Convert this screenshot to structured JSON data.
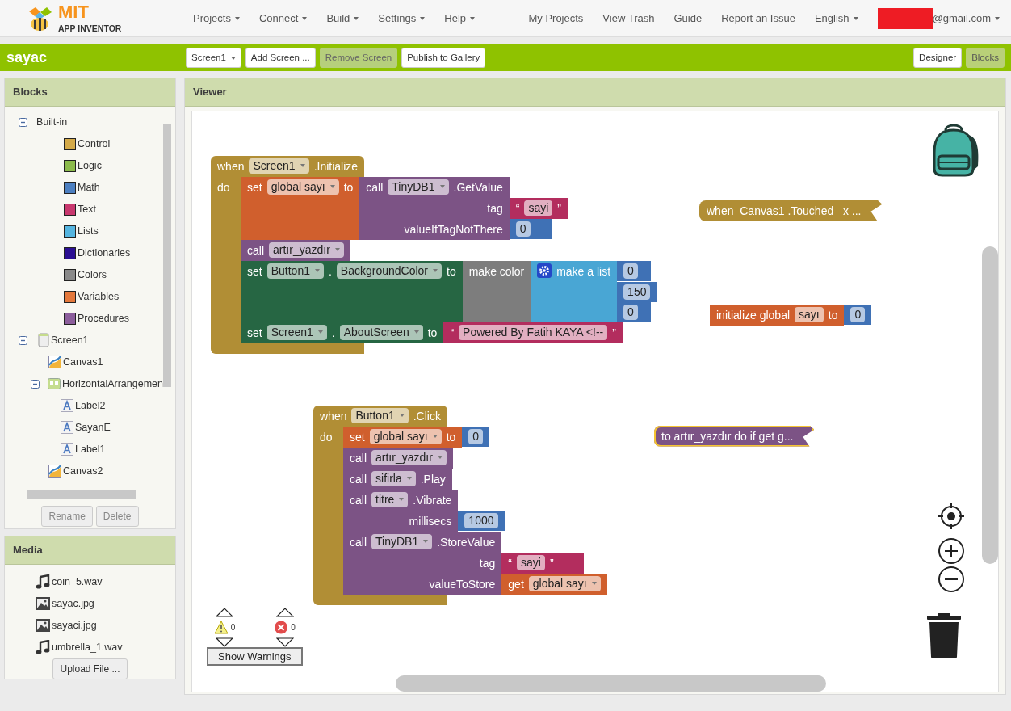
{
  "header": {
    "logo_title": "MIT",
    "logo_subtitle": "APP INVENTOR",
    "menus": [
      {
        "label": "Projects"
      },
      {
        "label": "Connect"
      },
      {
        "label": "Build"
      },
      {
        "label": "Settings"
      },
      {
        "label": "Help"
      }
    ],
    "links": [
      "My Projects",
      "View Trash",
      "Guide",
      "Report an Issue"
    ],
    "language": "English",
    "account": "@gmail.com"
  },
  "toolbar": {
    "project_name": "sayac",
    "buttons": [
      {
        "label": "Screen1",
        "dropdown": true,
        "disabled": false
      },
      {
        "label": "Add Screen ...",
        "dropdown": false,
        "disabled": false
      },
      {
        "label": "Remove Screen",
        "dropdown": false,
        "disabled": true
      },
      {
        "label": "Publish to Gallery",
        "dropdown": false,
        "disabled": false
      }
    ],
    "view_buttons": [
      {
        "label": "Designer",
        "selected": false
      },
      {
        "label": "Blocks",
        "selected": true
      }
    ]
  },
  "blocks_panel": {
    "title": "Blocks",
    "tree": [
      {
        "label": "Built-in",
        "kind": "group",
        "expanded": true,
        "children": [
          {
            "label": "Control",
            "kind": "category",
            "color": "#d4aa49"
          },
          {
            "label": "Logic",
            "kind": "category",
            "color": "#8cbb4c"
          },
          {
            "label": "Math",
            "kind": "category",
            "color": "#4c7fc0"
          },
          {
            "label": "Text",
            "kind": "category",
            "color": "#c8386e"
          },
          {
            "label": "Lists",
            "kind": "category",
            "color": "#55b5e0"
          },
          {
            "label": "Dictionaries",
            "kind": "category",
            "color": "#2b0f92"
          },
          {
            "label": "Colors",
            "kind": "category",
            "color": "#8a8a8a"
          },
          {
            "label": "Variables",
            "kind": "category",
            "color": "#e4783c"
          },
          {
            "label": "Procedures",
            "kind": "category",
            "color": "#8c5e9c"
          }
        ]
      },
      {
        "label": "Screen1",
        "kind": "screen",
        "expanded": true,
        "children": [
          {
            "label": "Canvas1",
            "kind": "canvas"
          },
          {
            "label": "HorizontalArrangemen",
            "kind": "arrangement",
            "expanded": true,
            "children": [
              {
                "label": "Label2",
                "kind": "label"
              },
              {
                "label": "SayanE",
                "kind": "label"
              },
              {
                "label": "Label1",
                "kind": "label"
              }
            ]
          },
          {
            "label": "Canvas2",
            "kind": "canvas"
          }
        ]
      }
    ],
    "buttons": [
      {
        "label": "Rename",
        "disabled": true
      },
      {
        "label": "Delete",
        "disabled": true
      }
    ]
  },
  "media_panel": {
    "title": "Media",
    "files": [
      {
        "name": "coin_5.wav",
        "kind": "audio"
      },
      {
        "name": "sayac.jpg",
        "kind": "image"
      },
      {
        "name": "sayaci.jpg",
        "kind": "image"
      },
      {
        "name": "umbrella_1.wav",
        "kind": "audio"
      }
    ],
    "upload_button": "Upload File ..."
  },
  "viewer": {
    "title": "Viewer",
    "stacks": [
      {
        "selected": false,
        "collapsed": false,
        "block": {
          "kind": "event",
          "rows": [
            {
              "items": [
                {
                  "kind": "label",
                  "text": "when"
                },
                {
                  "kind": "field",
                  "text": "Screen1",
                  "dropdown": true
                },
                {
                  "kind": "label",
                  "text": ".Initialize"
                }
              ]
            }
          ],
          "do_label": "do",
          "statements": [
            {
              "kind": "variable_set",
              "rows": [
                {
                  "items": [
                    {
                      "kind": "label",
                      "text": "set"
                    },
                    {
                      "kind": "field",
                      "text": "global sayı",
                      "dropdown": true
                    },
                    {
                      "kind": "label",
                      "text": "to"
                    }
                  ],
                  "input": {
                    "kind": "component_method",
                    "rows": [
                      {
                        "items": [
                          {
                            "kind": "label",
                            "text": "call"
                          },
                          {
                            "kind": "field",
                            "text": "TinyDB1",
                            "dropdown": true
                          },
                          {
                            "kind": "label",
                            "text": ".GetValue"
                          }
                        ]
                      },
                      {
                        "items": [
                          {
                            "kind": "label",
                            "text": "tag"
                          }
                        ],
                        "input": {
                          "kind": "text",
                          "rows": [
                            {
                              "items": [
                                {
                                  "kind": "label",
                                  "text": "“"
                                },
                                {
                                  "kind": "field",
                                  "text": "sayi",
                                  "dropdown": false
                                },
                                {
                                  "kind": "label",
                                  "text": "”"
                                }
                              ]
                            }
                          ]
                        }
                      },
                      {
                        "items": [
                          {
                            "kind": "label",
                            "text": "valueIfTagNotThere"
                          }
                        ],
                        "input": {
                          "kind": "number",
                          "rows": [
                            {
                              "items": [
                                {
                                  "kind": "field",
                                  "text": "0",
                                  "dropdown": false
                                }
                              ]
                            }
                          ]
                        }
                      }
                    ]
                  }
                }
              ]
            },
            {
              "kind": "procedure_call",
              "rows": [
                {
                  "items": [
                    {
                      "kind": "label",
                      "text": "call"
                    },
                    {
                      "kind": "field",
                      "text": "artır_yazdır",
                      "dropdown": true
                    }
                  ]
                }
              ]
            },
            {
              "kind": "component_set",
              "rows": [
                {
                  "items": [
                    {
                      "kind": "label",
                      "text": "set"
                    },
                    {
                      "kind": "field",
                      "text": "Button1",
                      "dropdown": true
                    },
                    {
                      "kind": "label",
                      "text": "."
                    },
                    {
                      "kind": "field",
                      "text": "BackgroundColor",
                      "dropdown": true
                    },
                    {
                      "kind": "label",
                      "text": "to"
                    }
                  ],
                  "input": {
                    "kind": "color",
                    "rows": [
                      {
                        "items": [
                          {
                            "kind": "label",
                            "text": "make color"
                          }
                        ],
                        "input": {
                          "kind": "list",
                          "mutator": true,
                          "rows": [
                            {
                              "items": [
                                {
                                  "kind": "label",
                                  "text": "make a list"
                                }
                              ],
                              "input": {
                                "kind": "number",
                                "rows": [
                                  {
                                    "items": [
                                      {
                                        "kind": "field",
                                        "text": "0",
                                        "dropdown": false
                                      }
                                    ]
                                  }
                                ]
                              }
                            },
                            {
                              "input": {
                                "kind": "number",
                                "rows": [
                                  {
                                    "items": [
                                      {
                                        "kind": "field",
                                        "text": "150",
                                        "dropdown": false
                                      }
                                    ]
                                  }
                                ]
                              }
                            },
                            {
                              "input": {
                                "kind": "number",
                                "rows": [
                                  {
                                    "items": [
                                      {
                                        "kind": "field",
                                        "text": "0",
                                        "dropdown": false
                                      }
                                    ]
                                  }
                                ]
                              }
                            }
                          ]
                        }
                      }
                    ]
                  }
                }
              ]
            },
            {
              "kind": "component_set",
              "rows": [
                {
                  "items": [
                    {
                      "kind": "label",
                      "text": "set"
                    },
                    {
                      "kind": "field",
                      "text": "Screen1",
                      "dropdown": true
                    },
                    {
                      "kind": "label",
                      "text": "."
                    },
                    {
                      "kind": "field",
                      "text": "AboutScreen",
                      "dropdown": true
                    },
                    {
                      "kind": "label",
                      "text": "to"
                    }
                  ],
                  "input": {
                    "kind": "text",
                    "rows": [
                      {
                        "items": [
                          {
                            "kind": "label",
                            "text": "“"
                          },
                          {
                            "kind": "field",
                            "text": "Powered By Fatih KAYA <!--",
                            "dropdown": false
                          },
                          {
                            "kind": "label",
                            "text": "”"
                          }
                        ]
                      }
                    ]
                  }
                }
              ]
            }
          ]
        }
      },
      {
        "selected": false,
        "collapsed": true,
        "block": {
          "kind": "event",
          "rows": [
            {
              "items": [
                {
                  "kind": "label",
                  "text": "when  Canvas1 .Touched   x ..."
                }
              ]
            }
          ]
        }
      },
      {
        "selected": false,
        "collapsed": false,
        "block": {
          "kind": "variable_init",
          "rows": [
            {
              "items": [
                {
                  "kind": "label",
                  "text": "initialize global"
                },
                {
                  "kind": "field",
                  "text": "sayı",
                  "dropdown": false
                },
                {
                  "kind": "label",
                  "text": "to"
                }
              ],
              "input": {
                "kind": "number",
                "rows": [
                  {
                    "items": [
                      {
                        "kind": "field",
                        "text": "0",
                        "dropdown": false
                      }
                    ]
                  }
                ]
              }
            }
          ]
        }
      },
      {
        "selected": false,
        "collapsed": false,
        "block": {
          "kind": "event",
          "rows": [
            {
              "items": [
                {
                  "kind": "label",
                  "text": "when"
                },
                {
                  "kind": "field",
                  "text": "Button1",
                  "dropdown": true
                },
                {
                  "kind": "label",
                  "text": ".Click"
                }
              ]
            }
          ],
          "do_label": "do",
          "statements": [
            {
              "kind": "variable_set",
              "rows": [
                {
                  "items": [
                    {
                      "kind": "label",
                      "text": "set"
                    },
                    {
                      "kind": "field",
                      "text": "global sayı",
                      "dropdown": true
                    },
                    {
                      "kind": "label",
                      "text": "to"
                    }
                  ],
                  "input": {
                    "kind": "number",
                    "rows": [
                      {
                        "items": [
                          {
                            "kind": "field",
                            "text": "0",
                            "dropdown": false
                          }
                        ]
                      }
                    ]
                  }
                }
              ]
            },
            {
              "kind": "procedure_call",
              "rows": [
                {
                  "items": [
                    {
                      "kind": "label",
                      "text": "call"
                    },
                    {
                      "kind": "field",
                      "text": "artır_yazdır",
                      "dropdown": true
                    }
                  ]
                }
              ]
            },
            {
              "kind": "component_method",
              "rows": [
                {
                  "items": [
                    {
                      "kind": "label",
                      "text": "call"
                    },
                    {
                      "kind": "field",
                      "text": "sifirla",
                      "dropdown": true
                    },
                    {
                      "kind": "label",
                      "text": ".Play"
                    }
                  ]
                }
              ]
            },
            {
              "kind": "component_method",
              "rows": [
                {
                  "items": [
                    {
                      "kind": "label",
                      "text": "call"
                    },
                    {
                      "kind": "field",
                      "text": "titre",
                      "dropdown": true
                    },
                    {
                      "kind": "label",
                      "text": ".Vibrate"
                    }
                  ]
                },
                {
                  "items": [
                    {
                      "kind": "label",
                      "text": "millisecs"
                    }
                  ],
                  "input": {
                    "kind": "number",
                    "rows": [
                      {
                        "items": [
                          {
                            "kind": "field",
                            "text": "1000",
                            "dropdown": false
                          }
                        ]
                      }
                    ]
                  }
                }
              ]
            },
            {
              "kind": "component_method",
              "rows": [
                {
                  "items": [
                    {
                      "kind": "label",
                      "text": "call"
                    },
                    {
                      "kind": "field",
                      "text": "TinyDB1",
                      "dropdown": true
                    },
                    {
                      "kind": "label",
                      "text": ".StoreValue"
                    }
                  ]
                },
                {
                  "items": [
                    {
                      "kind": "label",
                      "text": "tag"
                    }
                  ],
                  "input": {
                    "kind": "text",
                    "rows": [
                      {
                        "items": [
                          {
                            "kind": "label",
                            "text": "“"
                          },
                          {
                            "kind": "field",
                            "text": "sayi",
                            "dropdown": false
                          },
                          {
                            "kind": "label",
                            "text": "”"
                          }
                        ]
                      }
                    ]
                  }
                },
                {
                  "items": [
                    {
                      "kind": "label",
                      "text": "valueToStore"
                    }
                  ],
                  "input": {
                    "kind": "variable_get",
                    "rows": [
                      {
                        "items": [
                          {
                            "kind": "label",
                            "text": "get"
                          },
                          {
                            "kind": "field",
                            "text": "global sayı",
                            "dropdown": true
                          }
                        ]
                      }
                    ]
                  }
                }
              ]
            }
          ]
        }
      },
      {
        "selected": true,
        "collapsed": true,
        "block": {
          "kind": "procedure_def",
          "rows": [
            {
              "items": [
                {
                  "kind": "label",
                  "text": "to artır_yazdır do if get g..."
                }
              ]
            }
          ]
        }
      }
    ],
    "warnings": {
      "warning_count": "0",
      "error_count": "0",
      "toggle_label": "Show Warnings"
    }
  }
}
